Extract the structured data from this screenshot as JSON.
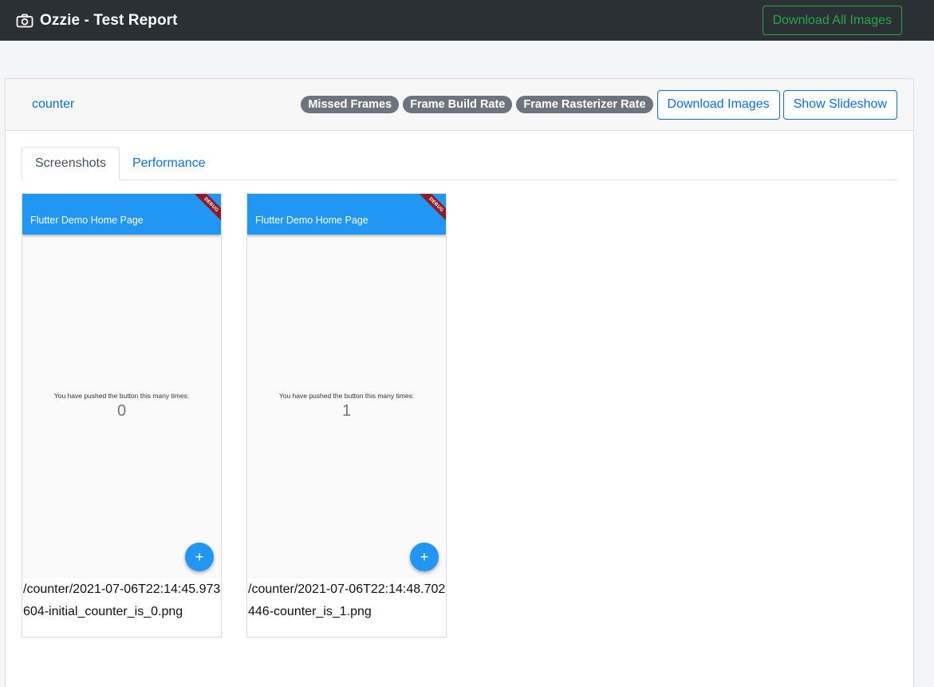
{
  "navbar": {
    "title": "Ozzie - Test Report",
    "icon": "camera-icon",
    "download_all_label": "Download All Images"
  },
  "suite": {
    "name": "counter",
    "badges": [
      "Missed Frames",
      "Frame Build Rate",
      "Frame Rasterizer Rate"
    ],
    "download_images_label": "Download Images",
    "slideshow_label": "Show Slideshow"
  },
  "tabs": [
    {
      "label": "Screenshots",
      "active": true
    },
    {
      "label": "Performance",
      "active": false
    }
  ],
  "screenshots": [
    {
      "appbar_title": "Flutter Demo Home Page",
      "debug_label": "DEBUG",
      "message": "You have pushed the button this many times:",
      "counter": "0",
      "fab_label": "+",
      "caption": "/counter/2021-07-06T22:14:45.973604-initial_counter_is_0.png"
    },
    {
      "appbar_title": "Flutter Demo Home Page",
      "debug_label": "DEBUG",
      "message": "You have pushed the button this many times:",
      "counter": "1",
      "fab_label": "+",
      "caption": "/counter/2021-07-06T22:14:48.702446-counter_is_1.png"
    }
  ],
  "colors": {
    "navbar": "#2b3035",
    "success": "#28a745",
    "primary": "#0d6efd",
    "badge": "#6c757d",
    "flutter_blue": "#2196f3"
  }
}
